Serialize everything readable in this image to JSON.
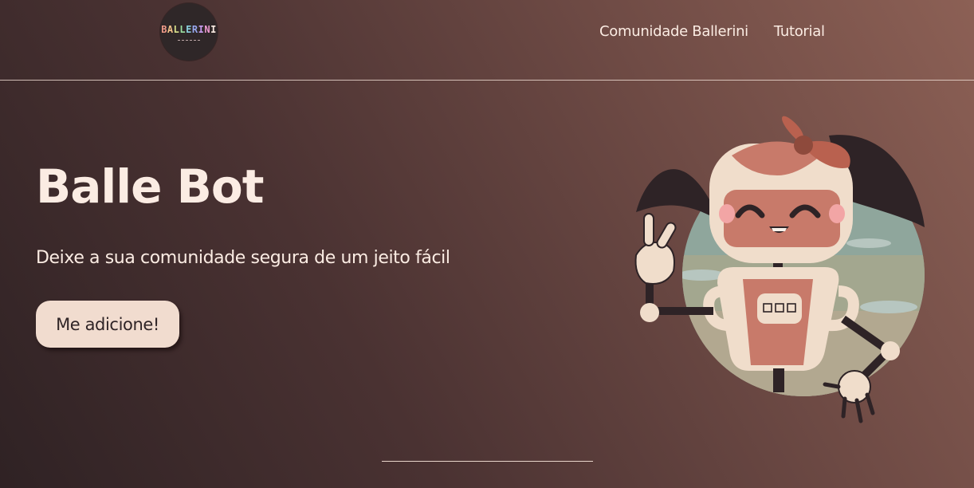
{
  "header": {
    "logo_text": "BALLERINI",
    "nav": [
      {
        "label": "Comunidade Ballerini"
      },
      {
        "label": "Tutorial"
      }
    ]
  },
  "hero": {
    "title": "Balle Bot",
    "subtitle": "Deixe a sua comunidade segura de um jeito fácil",
    "cta_label": "Me adicione!"
  },
  "icons": {
    "logo": "ballerini-logo-icon",
    "illustration": "robot-mascot-illustration"
  },
  "colors": {
    "text": "#fbece3",
    "button_bg": "#f1dccf",
    "button_text": "#2f2426",
    "accent": "#c87a6a"
  }
}
